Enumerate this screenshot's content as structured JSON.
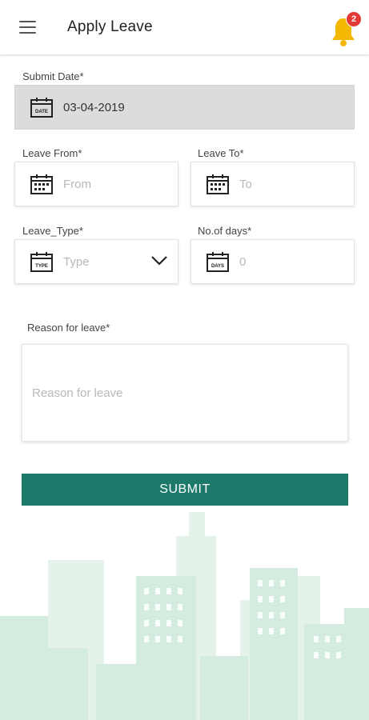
{
  "appbar": {
    "title": "Apply Leave",
    "notification_count": "2"
  },
  "form": {
    "submit_date": {
      "label": "Submit Date*",
      "value": "03-04-2019",
      "icon_text": "DATE"
    },
    "leave_from": {
      "label": "Leave From*",
      "placeholder": "From"
    },
    "leave_to": {
      "label": "Leave To*",
      "placeholder": "To"
    },
    "leave_type": {
      "label": "Leave_Type*",
      "placeholder": "Type",
      "icon_text": "TYPE"
    },
    "no_of_days": {
      "label": "No.of days*",
      "value": "0",
      "icon_text": "DAYS"
    },
    "reason": {
      "label": "Reason for leave*",
      "placeholder": "Reason for leave"
    },
    "submit_label": "SUBMIT"
  },
  "colors": {
    "primary": "#1d7a6a",
    "badge": "#e53935",
    "bell": "#f5b800",
    "skyline": "#dcefe5"
  }
}
